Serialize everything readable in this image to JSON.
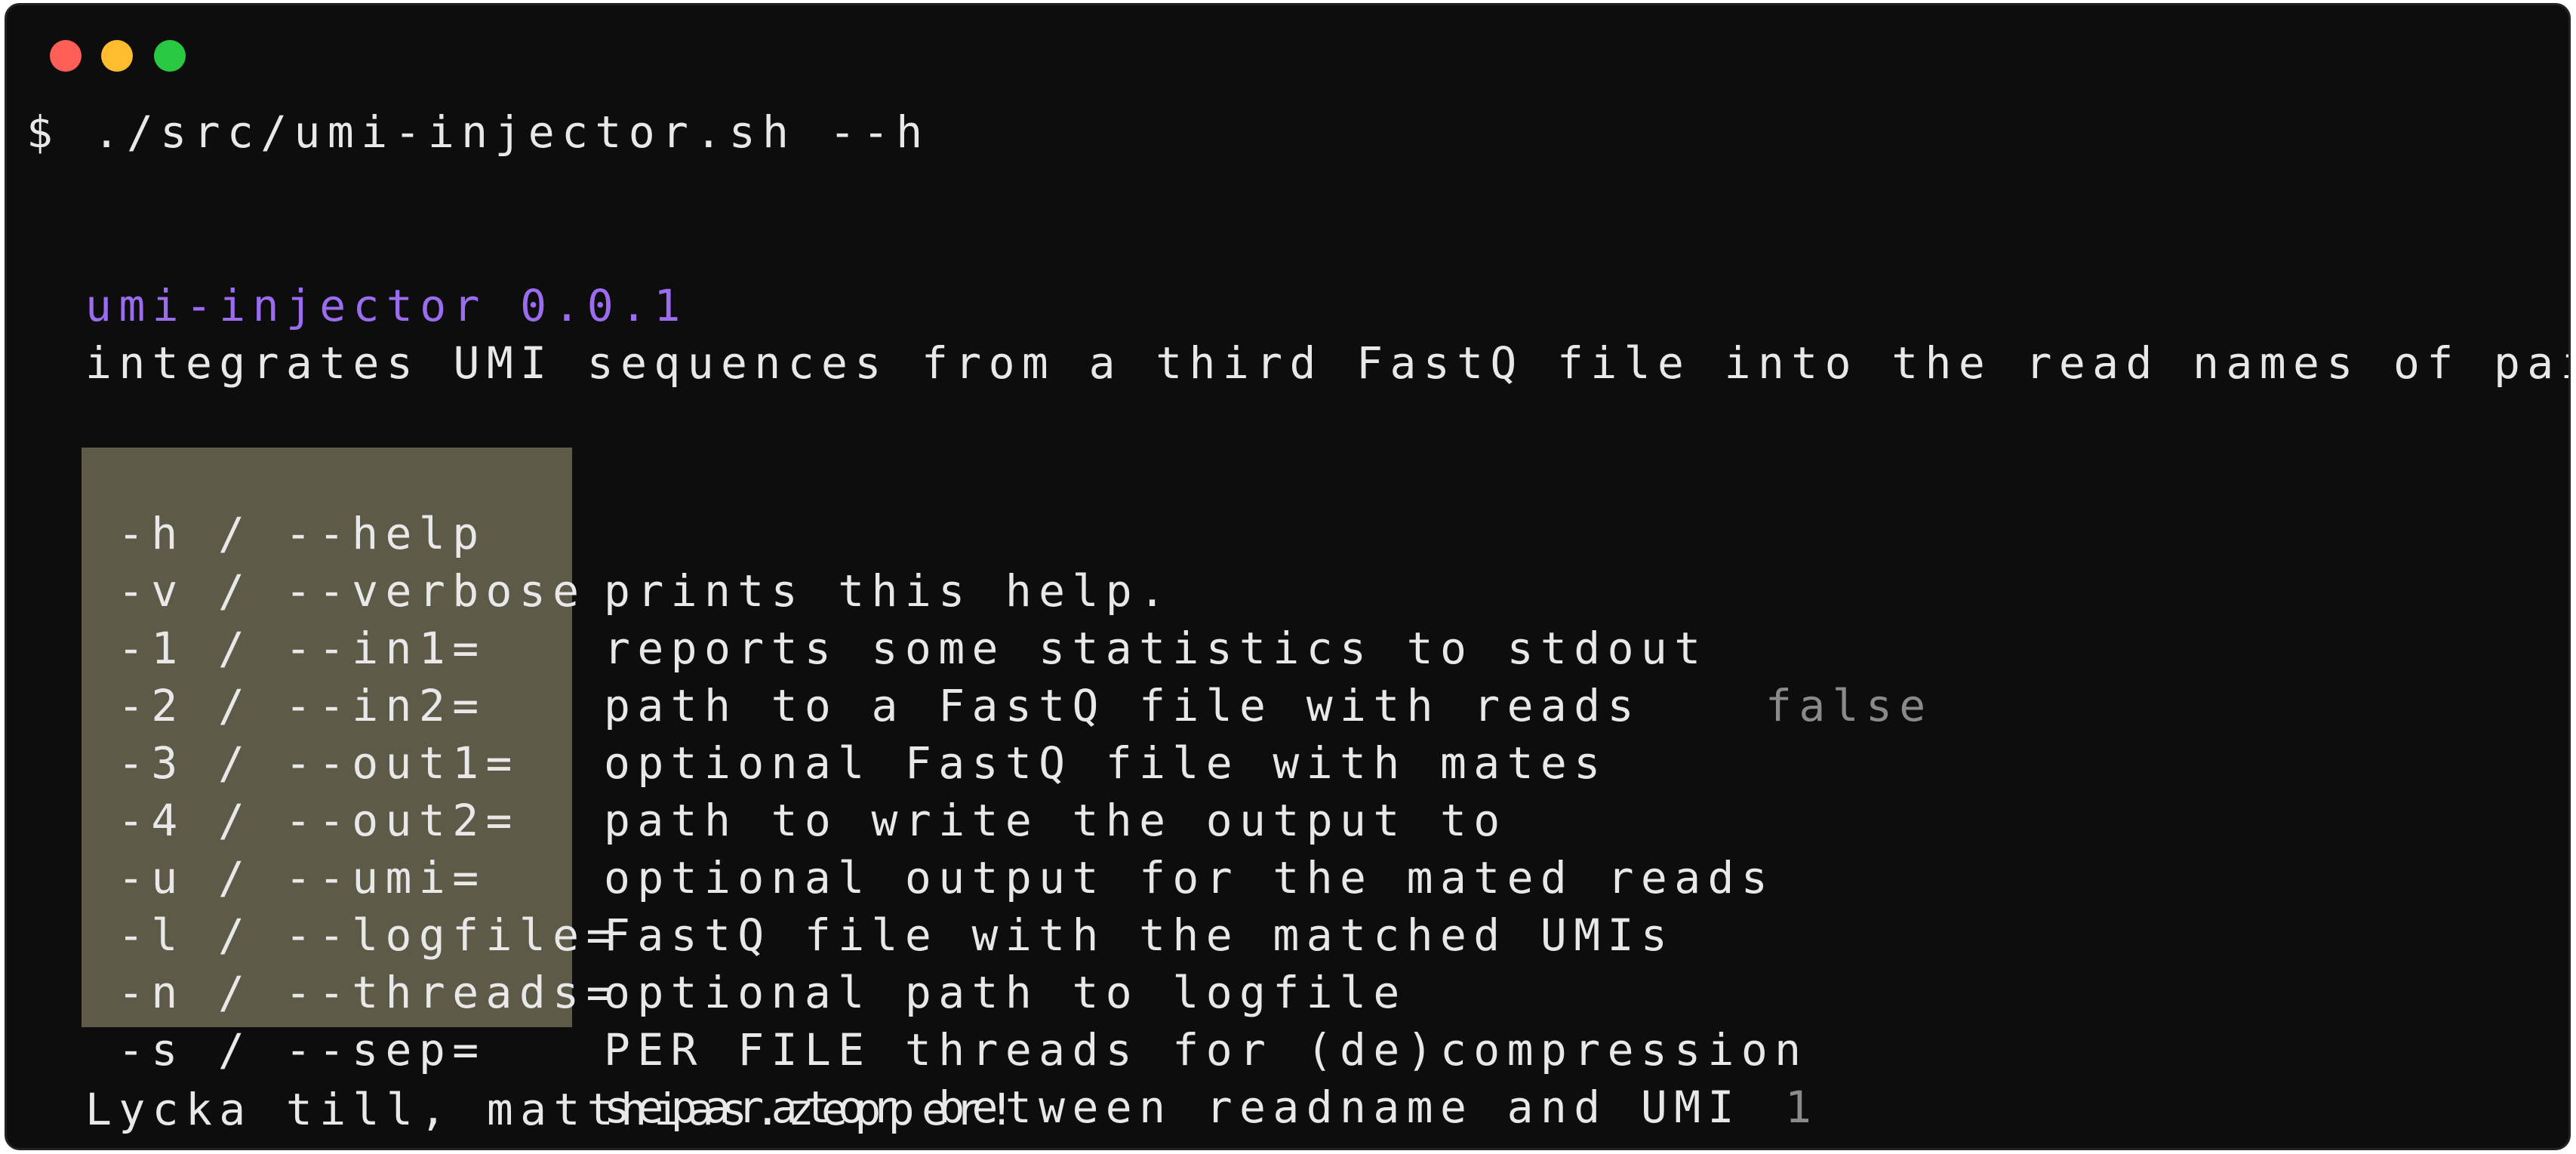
{
  "window": {
    "controls": [
      "close",
      "minimize",
      "zoom"
    ]
  },
  "terminal": {
    "prompt": "$ ./src/umi-injector.sh --h",
    "title": "umi-injector 0.0.1",
    "description": "integrates UMI sequences from a third FastQ file into the read names of paired FastQs.",
    "options": [
      {
        "flag": "-h / --help",
        "desc": "prints this help.",
        "default": ""
      },
      {
        "flag": "-v / --verbose",
        "desc": "reports some statistics to stdout",
        "default": "false"
      },
      {
        "flag": "-1 / --in1=",
        "desc": "path to a FastQ file with reads",
        "default": ""
      },
      {
        "flag": "-2 / --in2=",
        "desc": "optional FastQ file with mates",
        "default": ""
      },
      {
        "flag": "-3 / --out1=",
        "desc": "path to write the output to",
        "default": ""
      },
      {
        "flag": "-4 / --out2=",
        "desc": "optional output for the mated reads",
        "default": ""
      },
      {
        "flag": "-u / --umi=",
        "desc": "FastQ file with the matched UMIs",
        "default": ""
      },
      {
        "flag": "-l / --logfile=",
        "desc": "optional path to logfile",
        "default": ""
      },
      {
        "flag": "-n / --threads=",
        "desc": "PER FILE threads for (de)compression",
        "default": "1"
      },
      {
        "flag": "-s / --sep=",
        "desc": "separator between readname and UMI",
        "default": ":"
      }
    ],
    "footer": "Lycka till, matthias.zepper!"
  },
  "colors": {
    "background": "#0d0d0d",
    "text": "#e8e8e8",
    "title": "#9b6cf0",
    "flag_highlight": "#5d5a48",
    "default_value": "#8a8a8a"
  }
}
